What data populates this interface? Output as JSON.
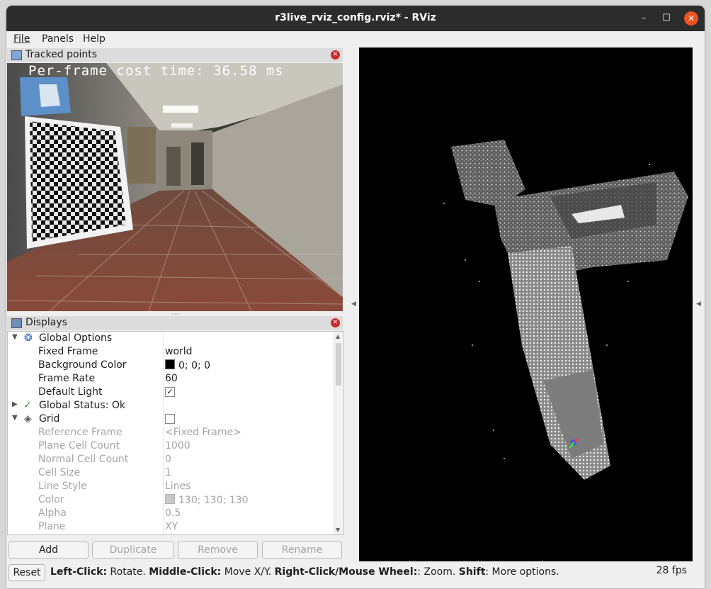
{
  "window": {
    "title": "r3live_rviz_config.rviz* - RViz"
  },
  "menu": {
    "file": "File",
    "panels": "Panels",
    "help": "Help"
  },
  "tracked_panel": {
    "title": "Tracked points",
    "overlay_text": "Per-frame cost time: 36.58 ms"
  },
  "displays_panel": {
    "title": "Displays"
  },
  "tree": {
    "global_options": "Global Options",
    "fixed_frame": {
      "label": "Fixed Frame",
      "value": "world"
    },
    "background_color": {
      "label": "Background Color",
      "value": "0; 0; 0",
      "color": "#000000"
    },
    "frame_rate": {
      "label": "Frame Rate",
      "value": "60"
    },
    "default_light": {
      "label": "Default Light",
      "checked": true,
      "mark": "✓"
    },
    "global_status": "Global Status: Ok",
    "grid": "Grid",
    "reference_frame": {
      "label": "Reference Frame",
      "value": "<Fixed Frame>"
    },
    "plane_cell_count": {
      "label": "Plane Cell Count",
      "value": "1000"
    },
    "normal_cell_count": {
      "label": "Normal Cell Count",
      "value": "0"
    },
    "cell_size": {
      "label": "Cell Size",
      "value": "1"
    },
    "line_style": {
      "label": "Line Style",
      "value": "Lines"
    },
    "color": {
      "label": "Color",
      "value": "130; 130; 130",
      "color": "#828282"
    },
    "alpha": {
      "label": "Alpha",
      "value": "0.5"
    },
    "plane": {
      "label": "Plane",
      "value": "XY"
    }
  },
  "buttons": {
    "add": "Add",
    "duplicate": "Duplicate",
    "remove": "Remove",
    "rename": "Rename"
  },
  "status": {
    "reset": "Reset",
    "left_click_key": "Left-Click:",
    "left_click_action": " Rotate. ",
    "middle_click_key": "Middle-Click:",
    "middle_click_action": " Move X/Y. ",
    "right_click_key": "Right-Click/Mouse Wheel:",
    "right_click_action": ": Zoom. ",
    "shift_key": "Shift",
    "shift_action": ": More options.",
    "fps": "28 fps"
  }
}
